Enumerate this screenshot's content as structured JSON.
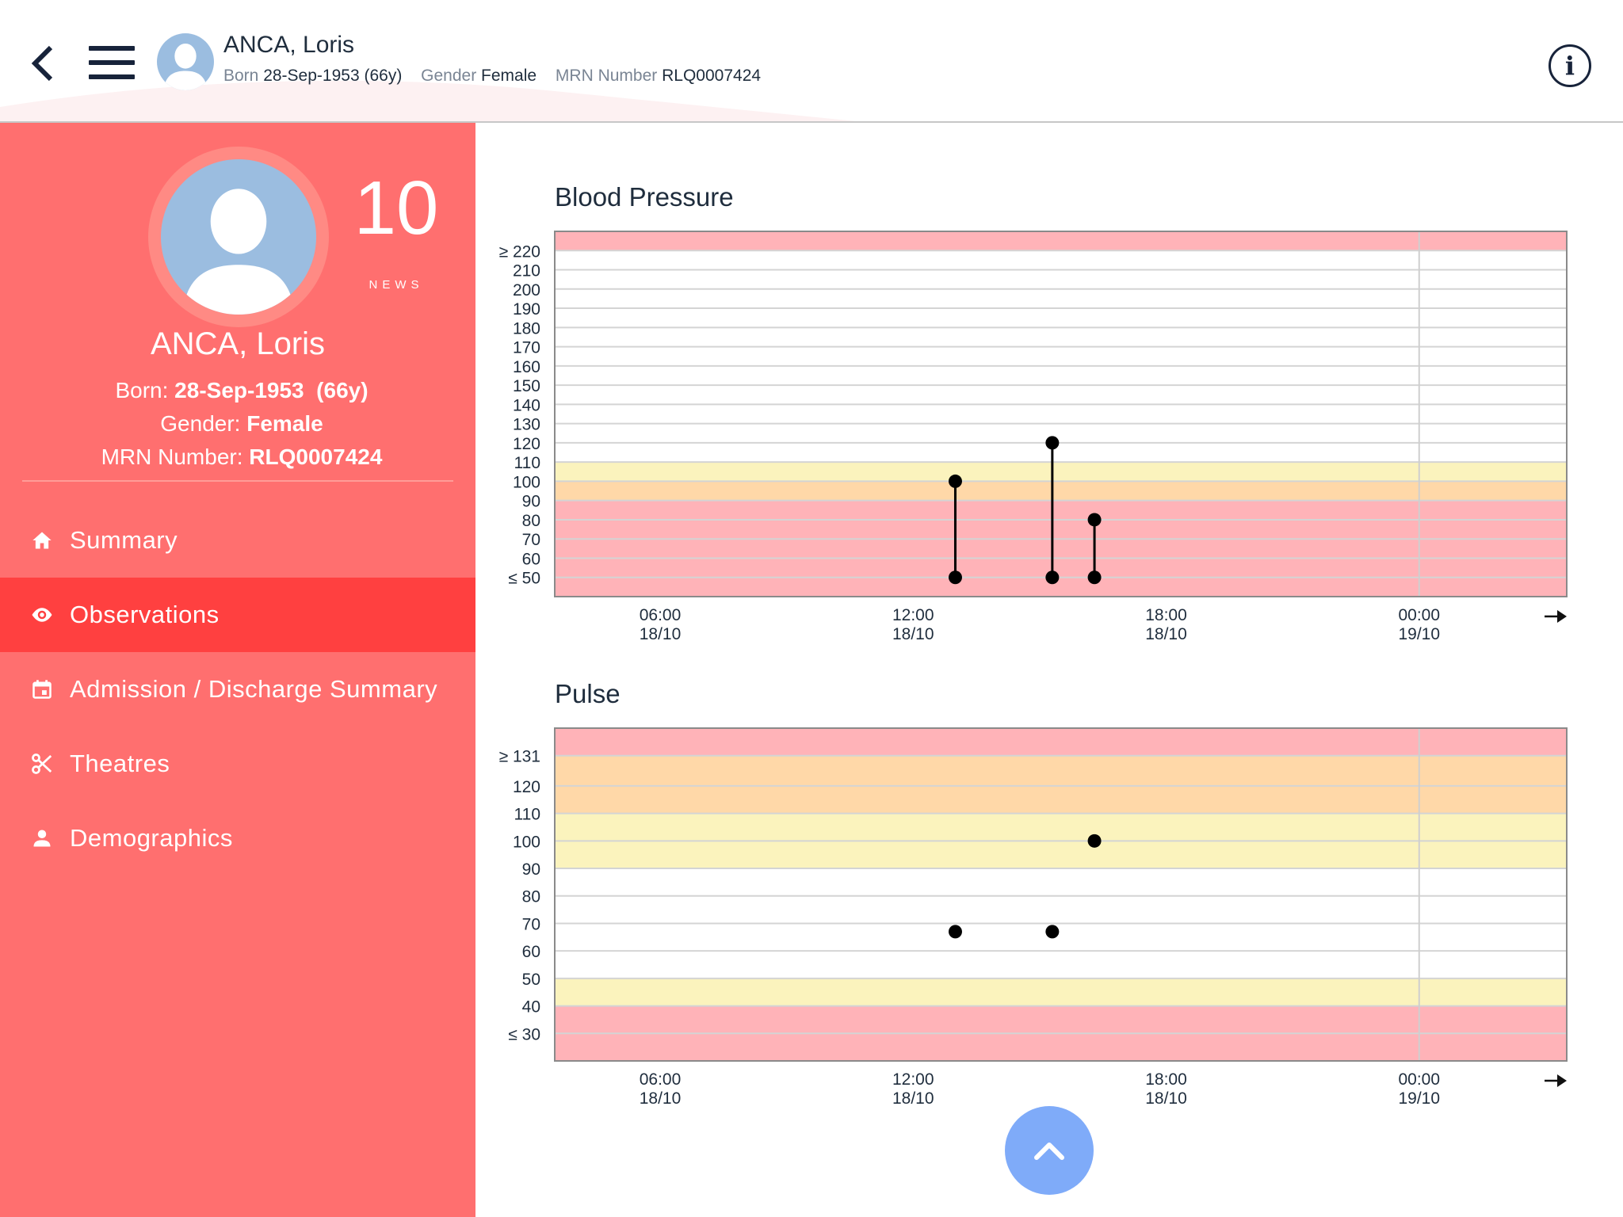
{
  "header": {
    "patient_name": "ANCA, Loris",
    "born_label": "Born",
    "born_value": "28-Sep-1953 (66y)",
    "gender_label": "Gender",
    "gender_value": "Female",
    "mrn_label": "MRN Number",
    "mrn_value": "RLQ0007424",
    "info_label": "i"
  },
  "sidebar": {
    "news_score": "10",
    "news_label": "NEWS",
    "patient_name": "ANCA, Loris",
    "born_label": "Born:",
    "born_date": "28-Sep-1953",
    "born_age": "(66y)",
    "gender_label": "Gender:",
    "gender_value": "Female",
    "mrn_label": "MRN Number:",
    "mrn_value": "RLQ0007424",
    "nav": [
      {
        "label": "Summary",
        "icon": "home-icon",
        "active": false
      },
      {
        "label": "Observations",
        "icon": "eye-icon",
        "active": true
      },
      {
        "label": "Admission / Discharge Summary",
        "icon": "calendar-icon",
        "active": false
      },
      {
        "label": "Theatres",
        "icon": "scissors-icon",
        "active": false
      },
      {
        "label": "Demographics",
        "icon": "person-icon",
        "active": false
      }
    ]
  },
  "colors": {
    "sidebar_bg": "#ff6f6f",
    "nav_active_bg": "#ff4040",
    "band_red": "#ffb3b8",
    "band_orange": "#ffd8a8",
    "band_yellow": "#fbf3bd",
    "scroll_button": "#7fabf9"
  },
  "chart_data": [
    {
      "type": "scatter",
      "title": "Blood Pressure",
      "y_ticks": [
        "≥ 220",
        "210",
        "200",
        "190",
        "180",
        "170",
        "160",
        "150",
        "140",
        "130",
        "120",
        "110",
        "100",
        "90",
        "80",
        "70",
        "60",
        "≤ 50"
      ],
      "ylim": [
        40,
        230
      ],
      "x_ticks": [
        {
          "time": "06:00",
          "date": "18/10",
          "t": 6
        },
        {
          "time": "12:00",
          "date": "18/10",
          "t": 12
        },
        {
          "time": "18:00",
          "date": "18/10",
          "t": 18
        },
        {
          "time": "00:00",
          "date": "19/10",
          "t": 24
        }
      ],
      "xlim": [
        3.5,
        27.5
      ],
      "bands": [
        {
          "from": 40,
          "to": 50,
          "color": "#ffb3b8"
        },
        {
          "from": 50,
          "to": 90,
          "color": "#ffb3b8"
        },
        {
          "from": 90,
          "to": 100,
          "color": "#ffd8a8"
        },
        {
          "from": 100,
          "to": 110,
          "color": "#fbf3bd"
        },
        {
          "from": 220,
          "to": 230,
          "color": "#ffb3b8"
        }
      ],
      "series": [
        {
          "t": 13.0,
          "systolic": 100,
          "diastolic": 50
        },
        {
          "t": 15.3,
          "systolic": 120,
          "diastolic": 50
        },
        {
          "t": 16.3,
          "systolic": 80,
          "diastolic": 50
        }
      ]
    },
    {
      "type": "scatter",
      "title": "Pulse",
      "y_ticks": [
        "≥ 131",
        "120",
        "110",
        "100",
        "90",
        "80",
        "70",
        "60",
        "50",
        "40",
        "≤ 30"
      ],
      "ylim": [
        20,
        141
      ],
      "x_ticks": [
        {
          "time": "06:00",
          "date": "18/10",
          "t": 6
        },
        {
          "time": "12:00",
          "date": "18/10",
          "t": 12
        },
        {
          "time": "18:00",
          "date": "18/10",
          "t": 18
        },
        {
          "time": "00:00",
          "date": "19/10",
          "t": 24
        }
      ],
      "xlim": [
        3.5,
        27.5
      ],
      "bands": [
        {
          "from": 20,
          "to": 40,
          "color": "#ffb3b8"
        },
        {
          "from": 40,
          "to": 50,
          "color": "#fbf3bd"
        },
        {
          "from": 90,
          "to": 110,
          "color": "#fbf3bd"
        },
        {
          "from": 110,
          "to": 131,
          "color": "#ffd8a8"
        },
        {
          "from": 131,
          "to": 141,
          "color": "#ffb3b8"
        }
      ],
      "series": [
        {
          "t": 13.0,
          "value": 67
        },
        {
          "t": 15.3,
          "value": 67
        },
        {
          "t": 16.3,
          "value": 100
        }
      ]
    }
  ]
}
